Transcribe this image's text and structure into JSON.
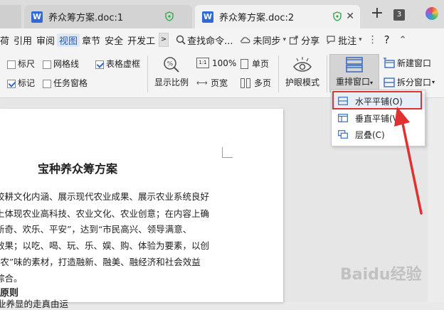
{
  "tabs": [
    {
      "title": "养众筹方案.doc:1",
      "icon": "W"
    },
    {
      "title": "养众筹方案.doc:2",
      "icon": "W"
    }
  ],
  "tabbar": {
    "new_tab": "+",
    "tab_count": "3"
  },
  "menu": {
    "items": [
      "荷",
      "引用",
      "审阅",
      "视图",
      "章节",
      "安全",
      "开发工"
    ],
    "more": ">",
    "search": "查找命令...",
    "sync": "未同步",
    "share": "分享",
    "comment": "批注",
    "help": "?"
  },
  "toolbar": {
    "checkboxes": [
      {
        "label": "标尺",
        "checked": false
      },
      {
        "label": "网格线",
        "checked": false
      },
      {
        "label": "表格虚框",
        "checked": true
      },
      {
        "label": "标记",
        "checked": true
      },
      {
        "label": "任务窗格",
        "checked": false
      }
    ],
    "zoom_label": "显示比例",
    "zoom_100": "100%",
    "page_width": "页宽",
    "single_page": "单页",
    "multi_page": "多页",
    "eye_mode": "护眼模式",
    "rearrange": "重排窗口",
    "new_window": "新建窗口",
    "split_window": "拆分窗口"
  },
  "dropdown": {
    "items": [
      {
        "label": "水平平铺(O)",
        "icon": "horizontal-tile-icon"
      },
      {
        "label": "垂直平铺(V",
        "icon": "vertical-tile-icon"
      },
      {
        "label": "层叠(C)",
        "icon": "cascade-icon"
      }
    ]
  },
  "document": {
    "title": "宝种养众筹方案",
    "lines": [
      "校耕文化内涵、展示现代农业成果、展示农业系统良好",
      "上体现农业高科技、农业文化、农业创意；在内容上确",
      "新奇、欢乐、平安”，达到“市民高兴、领导满意、",
      "效果；以吃、喝、玩、乐、娱、购、体验为要素，以创",
      "“农”味的素材，打造融新、融美、融经济和社会效益",
      "综合。"
    ],
    "heading": "原则",
    "last_line": "业养显的走真由运"
  },
  "watermark": "Baidu经验",
  "colors": {
    "accent": "#2e6ad6",
    "highlight": "#e03030"
  }
}
